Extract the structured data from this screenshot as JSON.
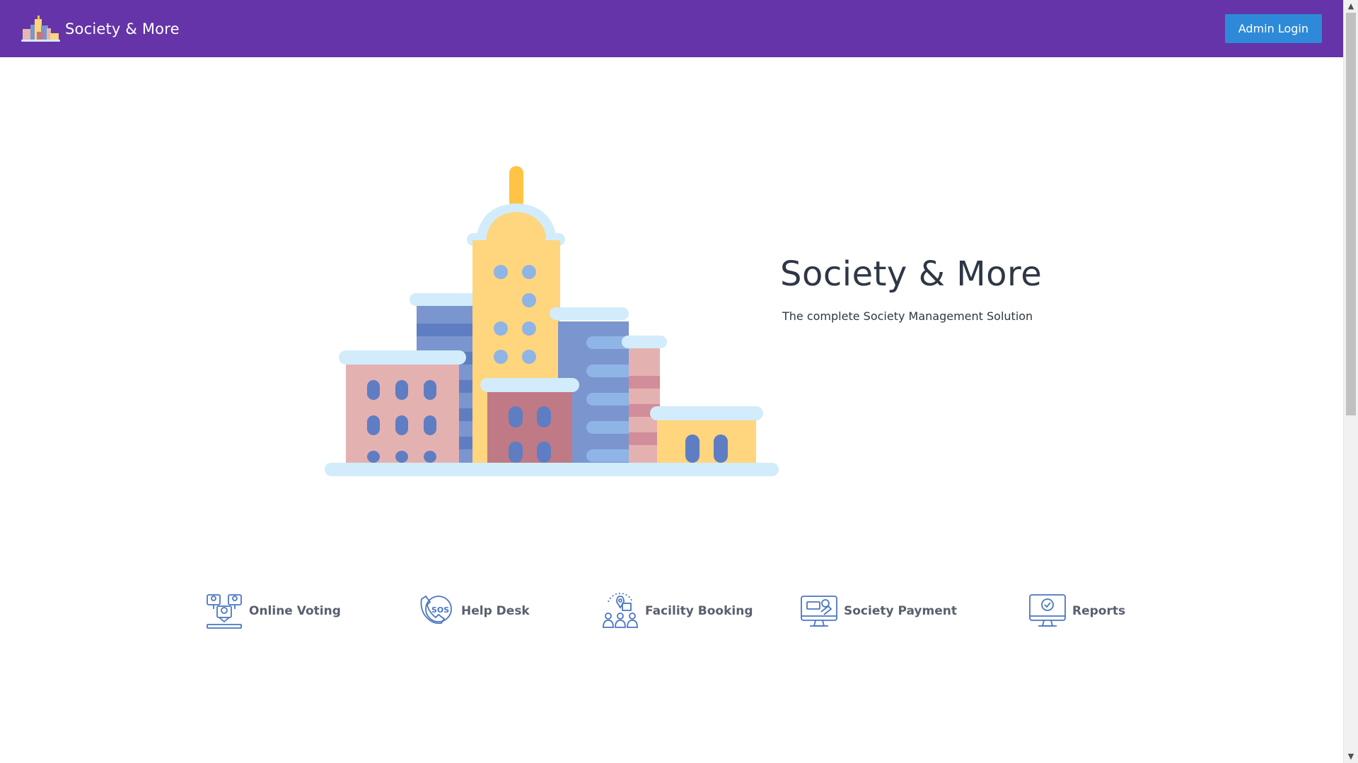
{
  "header": {
    "brand": "Society & More",
    "logo_icon": "city-buildings-logo-icon",
    "admin_login_label": "Admin Login"
  },
  "hero": {
    "illustration_icon": "city-buildings-illustration",
    "title": "Society & More",
    "subtitle": "The complete Society Management Solution"
  },
  "features": [
    {
      "label": "Online Voting",
      "icon": "online-voting-icon"
    },
    {
      "label": "Help Desk",
      "icon": "sos-phone-icon"
    },
    {
      "label": "Facility Booking",
      "icon": "facility-booking-icon"
    },
    {
      "label": "Society Payment",
      "icon": "payment-monitor-icon"
    },
    {
      "label": "Reports",
      "icon": "reports-monitor-icon"
    }
  ],
  "colors": {
    "navbar": "#6434a8",
    "button": "#2e8ad8",
    "icon_stroke": "#4a76c4",
    "text_dark": "#2e3745",
    "feature_text": "#5a5f6e"
  }
}
